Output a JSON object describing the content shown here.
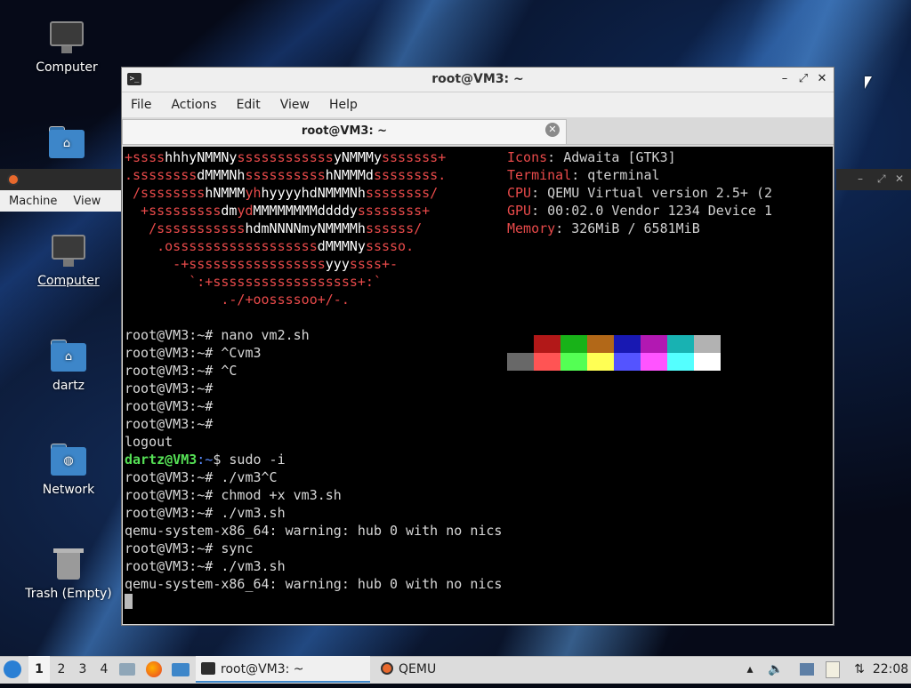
{
  "desktop": {
    "icons": [
      {
        "label": "Computer"
      },
      {
        "label": ""
      },
      {
        "label": "Computer"
      },
      {
        "label": "dartz"
      },
      {
        "label": "Network"
      },
      {
        "label": "Trash (Empty)"
      }
    ]
  },
  "background_window": {
    "menu": [
      "Machine",
      "View"
    ]
  },
  "terminal_window": {
    "title": "root@VM3: ~",
    "menu": [
      "File",
      "Actions",
      "Edit",
      "View",
      "Help"
    ],
    "tab_label": "root@VM3: ~",
    "neofetch_info": [
      {
        "key": "Icons",
        "value": ": Adwaita [GTK3]"
      },
      {
        "key": "Terminal",
        "value": ": qterminal"
      },
      {
        "key": "CPU",
        "value": ": QEMU Virtual version 2.5+ (2"
      },
      {
        "key": "GPU",
        "value": ": 00:02.0 Vendor 1234 Device 1"
      },
      {
        "key": "Memory",
        "value": ": 326MiB / 6581MiB"
      }
    ],
    "palette_top": [
      "#000000",
      "#b21818",
      "#18b218",
      "#b26818",
      "#1818b2",
      "#b218b2",
      "#18b2b2",
      "#b2b2b2"
    ],
    "palette_bottom": [
      "#686868",
      "#ff5454",
      "#54ff54",
      "#ffff54",
      "#5454ff",
      "#ff54ff",
      "#54ffff",
      "#ffffff"
    ],
    "lines": [
      "root@VM3:~# nano vm2.sh",
      "root@VM3:~# ^Cvm3",
      "root@VM3:~# ^C",
      "root@VM3:~#",
      "root@VM3:~#",
      "root@VM3:~#",
      "logout",
      "$ sudo -i",
      "root@VM3:~# ./vm3^C",
      "root@VM3:~# chmod +x vm3.sh",
      "root@VM3:~# ./vm3.sh",
      "qemu-system-x86_64: warning: hub 0 with no nics",
      "root@VM3:~# sync",
      "root@VM3:~# ./vm3.sh",
      "qemu-system-x86_64: warning: hub 0 with no nics"
    ],
    "user_prompt_user": "dartz@VM3",
    "user_prompt_path": ":~"
  },
  "taskbar": {
    "workspaces": [
      "1",
      "2",
      "3",
      "4"
    ],
    "active_workspace": "1",
    "tasks": [
      {
        "label": "root@VM3: ~"
      },
      {
        "label": "QEMU"
      }
    ],
    "clock": "22:08"
  }
}
